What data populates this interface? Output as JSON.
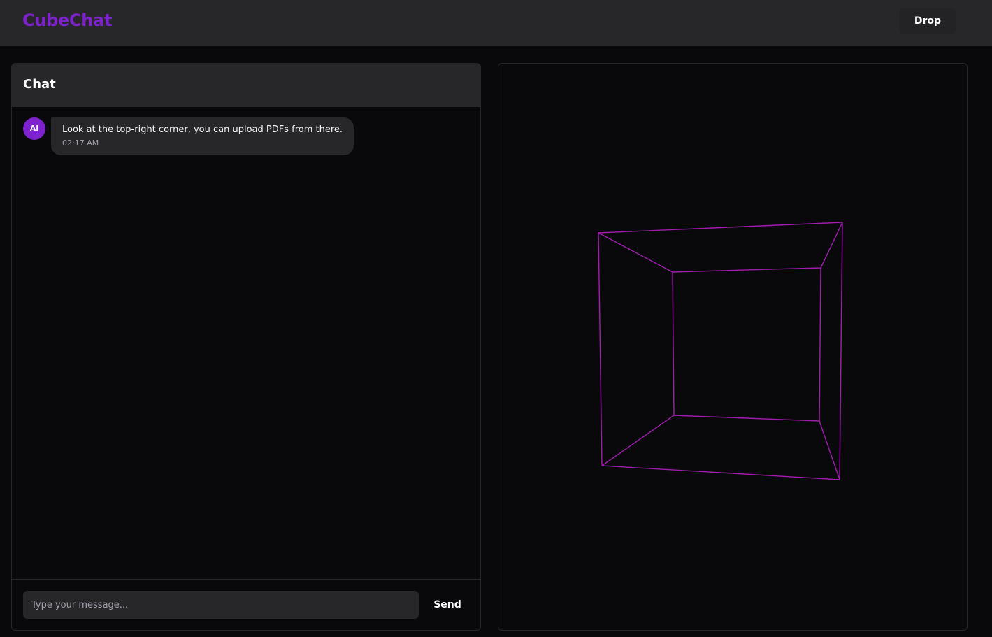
{
  "app": {
    "brand": "CubeChat",
    "drop_label": "Drop"
  },
  "colors": {
    "accent": "#7e22ce",
    "wire": "#a21caf",
    "panel": "#27272a",
    "background": "#09090b"
  },
  "chat": {
    "title": "Chat",
    "messages": [
      {
        "avatar": "AI",
        "text": "Look at the top-right corner, you can upload PDFs from there.",
        "time": "02:17 AM"
      }
    ],
    "input_placeholder": "Type your message...",
    "input_value": "",
    "send_label": "Send"
  },
  "viewer": {
    "object": "wireframe-cube",
    "edge_icon": "cube-icon"
  }
}
